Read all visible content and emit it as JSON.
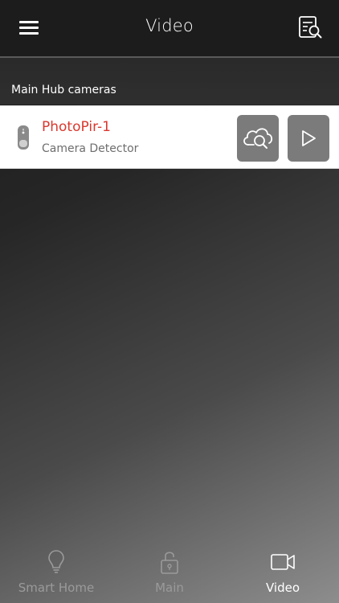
{
  "header": {
    "title": "Video",
    "menu_icon": "hamburger-menu-icon",
    "search_icon": "document-search-icon"
  },
  "section": {
    "title": "Main Hub cameras"
  },
  "camera": {
    "name": "PhotoPir-1",
    "type": "Camera Detector",
    "name_color": "#d9382e",
    "icon": "motion-detector-icon",
    "actions": [
      {
        "name": "cloud-search",
        "icon": "cloud-search-icon"
      },
      {
        "name": "play",
        "icon": "play-icon"
      }
    ]
  },
  "tabs": [
    {
      "label": "Smart Home",
      "icon": "lightbulb-icon",
      "active": false
    },
    {
      "label": "Main",
      "icon": "unlocked-padlock-icon",
      "active": false
    },
    {
      "label": "Video",
      "icon": "video-camera-icon",
      "active": true
    }
  ]
}
